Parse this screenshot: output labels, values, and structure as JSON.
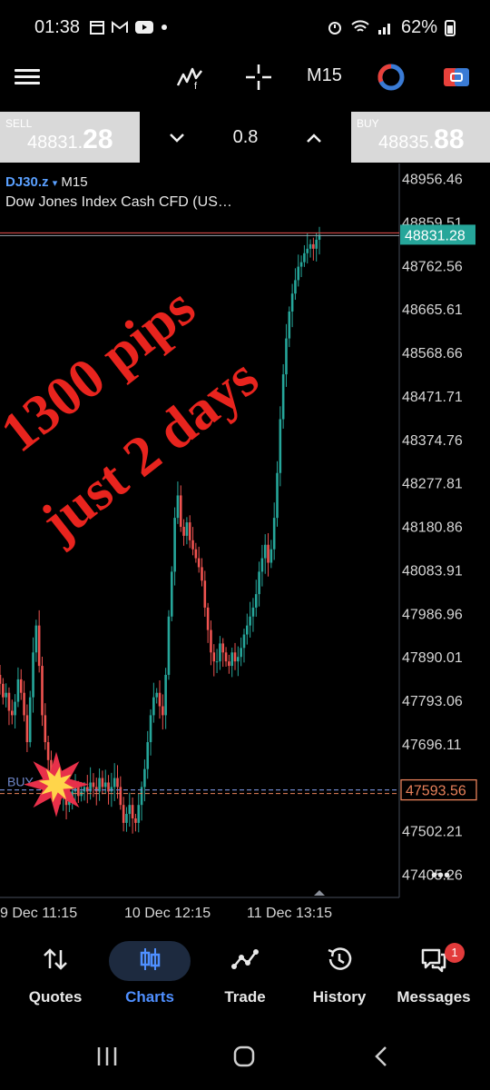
{
  "status_bar": {
    "time": "01:38",
    "battery": "62%",
    "icons": [
      "calendar-icon",
      "gmail-icon",
      "youtube-icon",
      "dot-icon",
      "alarm-icon",
      "wifi-icon",
      "signal-icon"
    ]
  },
  "toolbar": {
    "timeframe": "M15",
    "icons": [
      "menu-icon",
      "indicators-icon",
      "crosshair-icon",
      "timeframe-clock-icon",
      "one-click-trade-icon"
    ]
  },
  "quote": {
    "sell_label": "SELL",
    "sell_price_small": "48831.",
    "sell_price_big": "28",
    "buy_label": "BUY",
    "buy_price_small": "48835.",
    "buy_price_big": "88",
    "volume": "0.8"
  },
  "chart": {
    "symbol": "DJ30.z",
    "timeframe": "M15",
    "description": "Dow Jones Index Cash CFD (US…",
    "current_price_tag": "48831.28",
    "entry_price_tag": "47593.56",
    "entry_label": "BUY",
    "annotation_line1": "1300 pips",
    "annotation_line2": "just 2 days",
    "more_label": "•••",
    "colors": {
      "bull": "#26a69a",
      "bear": "#ef5350",
      "current_tag_bg": "#26a69a",
      "entry_tag": "#e8815a",
      "annotation": "#e8241e",
      "grid_border": "#3a3f4a"
    }
  },
  "chart_data": {
    "type": "candlestick",
    "title": "DJ30.z M15",
    "y_ticks": [
      "48956.46",
      "48859.51",
      "48762.56",
      "48665.61",
      "48568.66",
      "48471.71",
      "48374.76",
      "48277.81",
      "48180.86",
      "48083.91",
      "47986.96",
      "47890.01",
      "47793.06",
      "47696.11",
      "47593.56",
      "47502.21",
      "47405.26"
    ],
    "ylim": [
      47370,
      48990
    ],
    "x_labels": [
      "9 Dec 11:15",
      "10 Dec 12:15",
      "11 Dec 13:15"
    ],
    "current_price": 48831.28,
    "entry_price": 47593.56,
    "path_closes": [
      47830,
      47800,
      47810,
      47770,
      47760,
      47790,
      47840,
      47810,
      47760,
      47700,
      47800,
      47900,
      47960,
      47870,
      47760,
      47700,
      47660,
      47620,
      47600,
      47610,
      47580,
      47590,
      47560,
      47570,
      47590,
      47600,
      47580,
      47590,
      47600,
      47590,
      47610,
      47600,
      47590,
      47620,
      47600,
      47610,
      47590,
      47600,
      47620,
      47600,
      47560,
      47520,
      47540,
      47560,
      47530,
      47520,
      47560,
      47600,
      47640,
      47700,
      47760,
      47800,
      47810,
      47780,
      47760,
      47850,
      47980,
      48080,
      48200,
      48250,
      48180,
      48160,
      48190,
      48150,
      48130,
      48110,
      48090,
      48060,
      48000,
      47950,
      47900,
      47880,
      47880,
      47920,
      47900,
      47880,
      47870,
      47900,
      47880,
      47890,
      47910,
      47940,
      47960,
      47980,
      48000,
      48030,
      48080,
      48110,
      48140,
      48100,
      48130,
      48200,
      48300,
      48420,
      48520,
      48600,
      48660,
      48700,
      48730,
      48760,
      48770,
      48790,
      48800,
      48810,
      48800,
      48820,
      48831
    ]
  },
  "nav": {
    "items": [
      {
        "label": "Quotes"
      },
      {
        "label": "Charts"
      },
      {
        "label": "Trade"
      },
      {
        "label": "History"
      },
      {
        "label": "Messages",
        "badge": "1"
      }
    ],
    "active": "Charts"
  }
}
